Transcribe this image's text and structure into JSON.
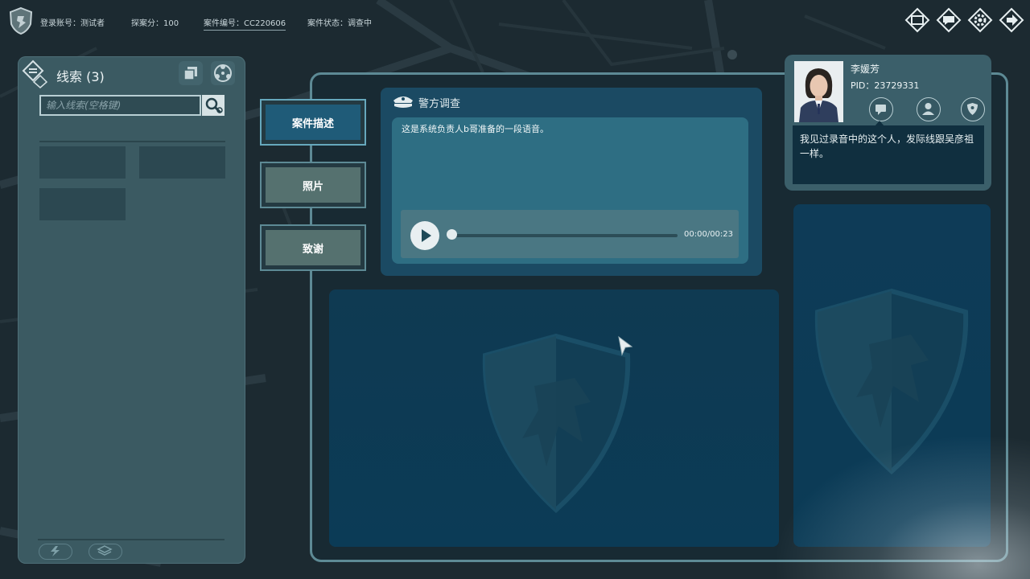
{
  "app": {
    "logo_icon": "police-shield-logo-icon"
  },
  "top_bar": {
    "account_label": "登录账号：",
    "account_value": "测试者",
    "score_label": "探案分：",
    "score_value": "100",
    "case_no_label": "案件编号：",
    "case_no_value": "CC220606",
    "case_status_label": "案件状态：",
    "case_status_value": "调查中",
    "buttons": [
      "window-icon",
      "speech-icon",
      "gear-icon",
      "exit-icon"
    ]
  },
  "clues": {
    "title": "线索",
    "count": "(3)",
    "search_placeholder": "输入线索(空格键)",
    "search_value": "",
    "slot_count": 3
  },
  "tabs": [
    {
      "label": "案件描述",
      "active": true
    },
    {
      "label": "照片",
      "active": false
    },
    {
      "label": "致谢",
      "active": false
    }
  ],
  "police_investigation": {
    "title": "警方调查",
    "description": "这是系统负责人b哥准备的一段语音。",
    "audio": {
      "current": "00:00",
      "total": "00:23",
      "time_display": "00:00/00:23",
      "progress": 0
    }
  },
  "person": {
    "name": "李媛芳",
    "pid_label": "PID：",
    "pid_value": "23729331",
    "quote": "我见过录音中的这个人，发际线跟吴彦祖一样。",
    "actions": [
      "chat-icon",
      "profile-icon",
      "badge-icon"
    ]
  },
  "colors": {
    "panel": "#3b5a62",
    "active_tab": "#1f5b78",
    "card": "#1b4a63",
    "accent_border": "#5d8a95"
  }
}
